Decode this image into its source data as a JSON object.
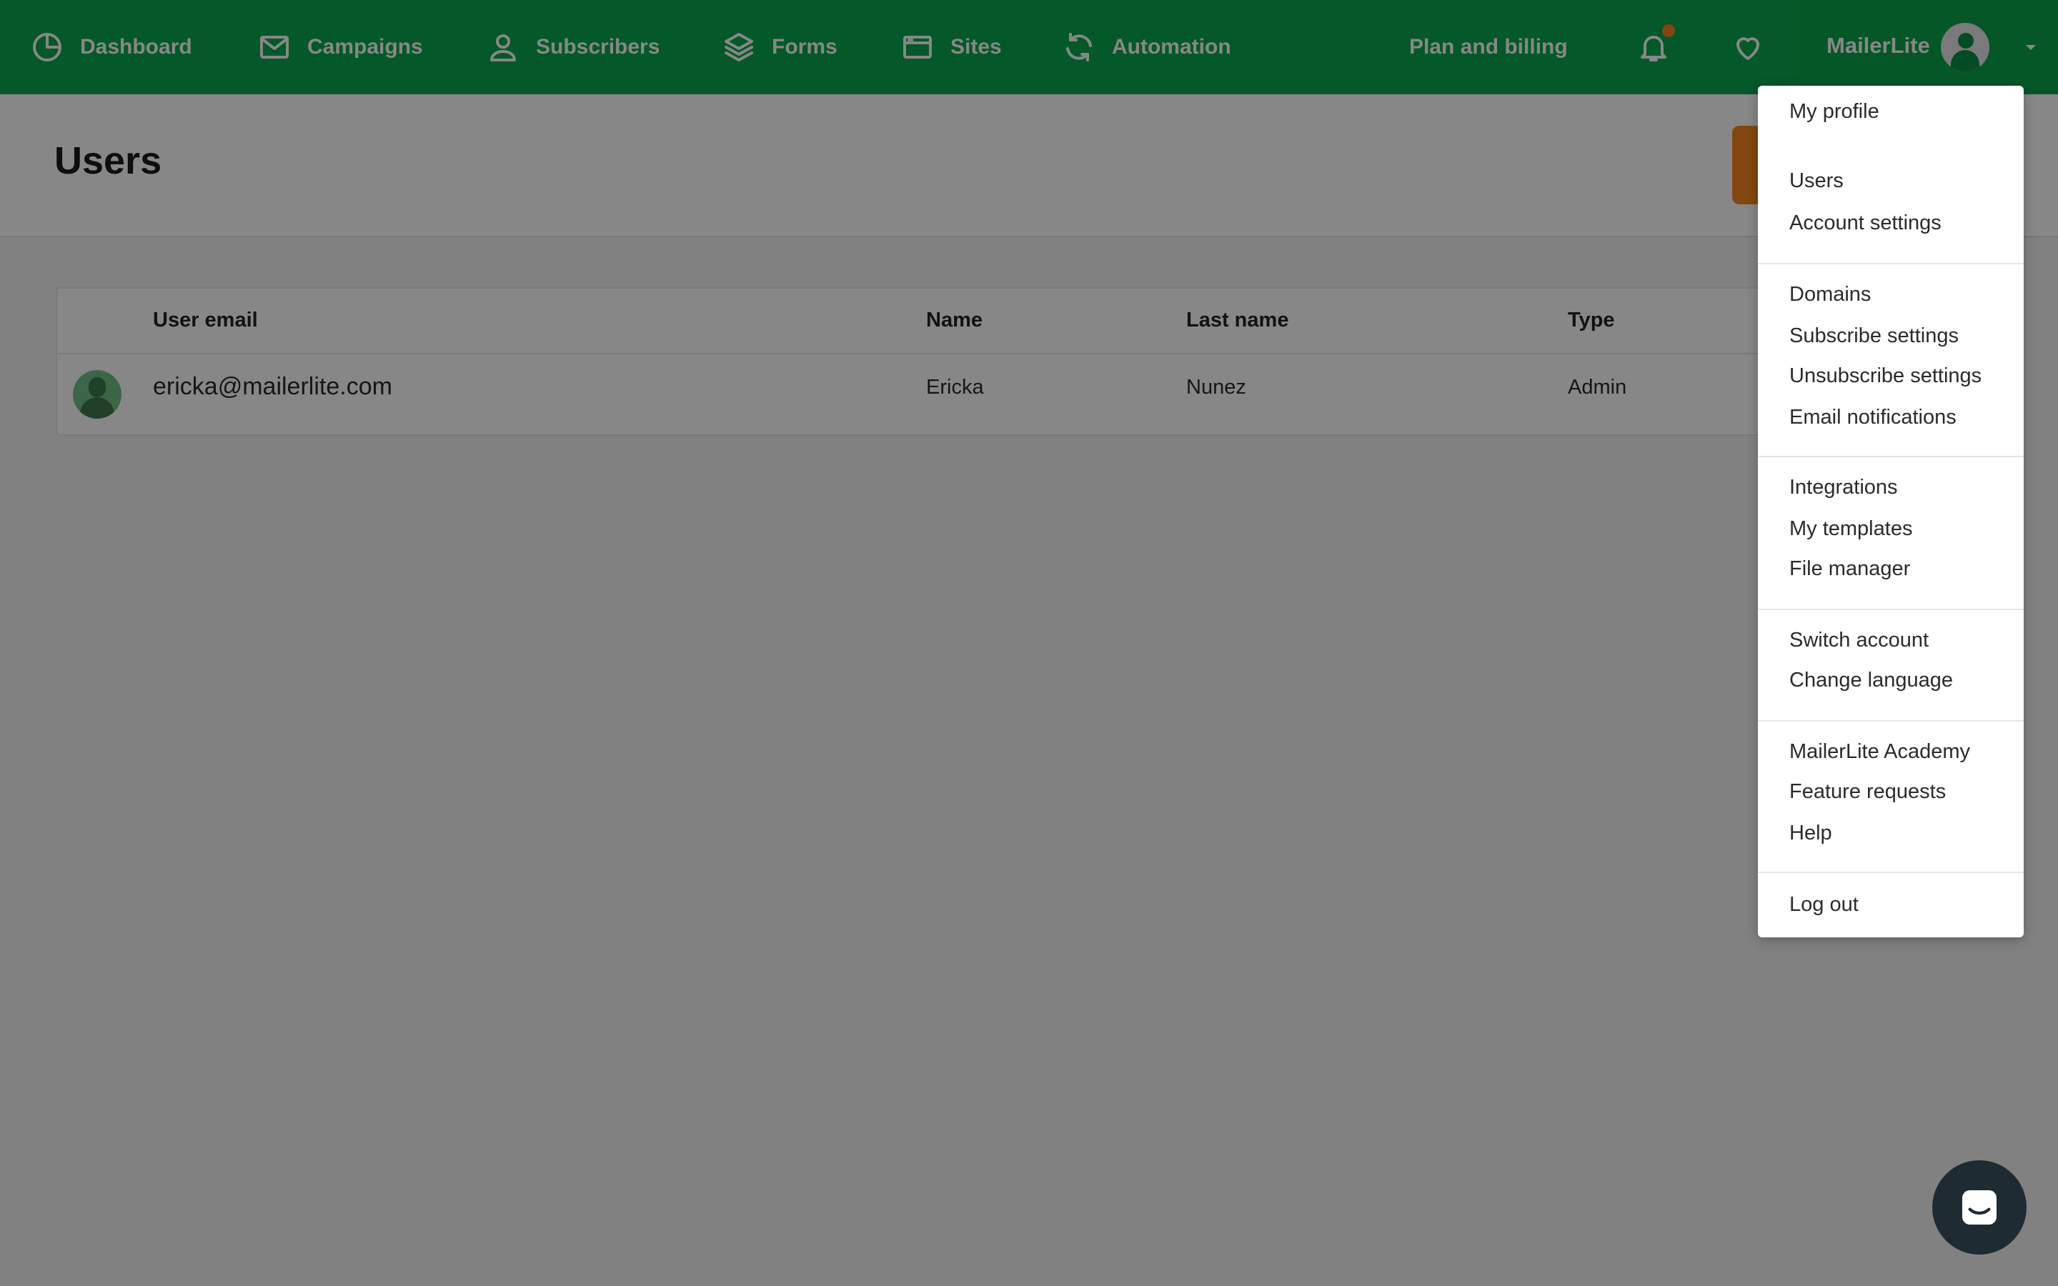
{
  "nav": {
    "items": [
      {
        "label": "Dashboard",
        "icon": "dashboard-icon"
      },
      {
        "label": "Campaigns",
        "icon": "mail-icon"
      },
      {
        "label": "Subscribers",
        "icon": "user-icon"
      },
      {
        "label": "Forms",
        "icon": "layers-icon"
      },
      {
        "label": "Sites",
        "icon": "browser-icon"
      },
      {
        "label": "Automation",
        "icon": "refresh-icon"
      }
    ],
    "plan_billing": "Plan and billing",
    "account_name": "MailerLite"
  },
  "page": {
    "title": "Users"
  },
  "table": {
    "headers": [
      "User email",
      "Name",
      "Last name",
      "Type"
    ],
    "rows": [
      {
        "email": "ericka@mailerlite.com",
        "name": "Ericka",
        "last_name": "Nunez",
        "type": "Admin"
      }
    ]
  },
  "menu": {
    "items": [
      "My profile",
      "Users",
      "Account settings",
      "Domains",
      "Subscribe settings",
      "Unsubscribe settings",
      "Email notifications",
      "Integrations",
      "My templates",
      "File manager",
      "Switch account",
      "Change language",
      "MailerLite Academy",
      "Feature requests",
      "Help",
      "Log out"
    ]
  },
  "colors": {
    "brand_green": "#09a74f",
    "accent_orange": "#f6871f",
    "notification_dot": "#f6871f"
  }
}
